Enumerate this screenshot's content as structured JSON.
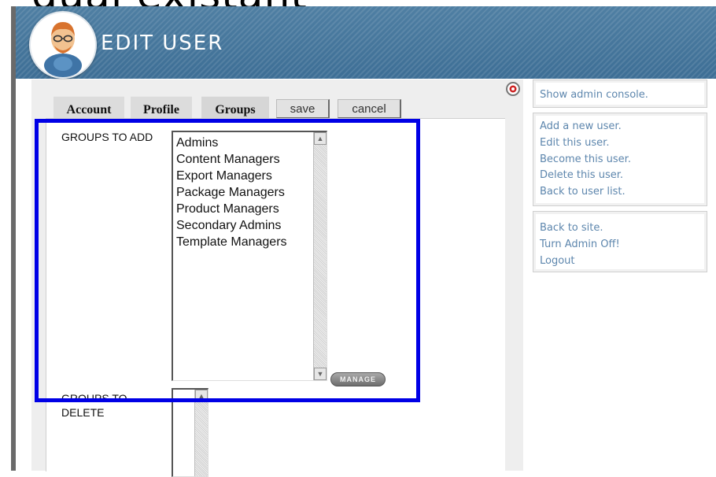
{
  "top_text": "dual existant",
  "header": {
    "title": "EDIT USER",
    "avatar": "user-avatar-icon"
  },
  "tabs": [
    {
      "label": "Account"
    },
    {
      "label": "Profile"
    },
    {
      "label": "Groups"
    }
  ],
  "buttons": {
    "save": "save",
    "cancel": "cancel",
    "manage": "MANAGE"
  },
  "form": {
    "groups_to_add_label": "GROUPS TO ADD",
    "groups_to_add_options": [
      "Admins",
      "Content Managers",
      "Export Managers",
      "Package Managers",
      "Product Managers",
      "Secondary Admins",
      "Template Managers"
    ],
    "groups_to_delete_label": "GROUPS TO DELETE",
    "groups_to_delete_options": []
  },
  "sidebar": {
    "console": {
      "label": "Show admin console."
    },
    "user_actions": [
      {
        "label": "Add a new user."
      },
      {
        "label": "Edit this user."
      },
      {
        "label": "Become this user."
      },
      {
        "label": "Delete this user."
      },
      {
        "label": "Back to user list."
      }
    ],
    "site_actions": [
      {
        "label": "Back to site."
      },
      {
        "label": "Turn Admin Off!"
      },
      {
        "label": "Logout"
      }
    ]
  },
  "colors": {
    "header_blue": "#4a7aa0",
    "link_blue": "#5d86ad",
    "highlight_blue": "#0000e6"
  }
}
